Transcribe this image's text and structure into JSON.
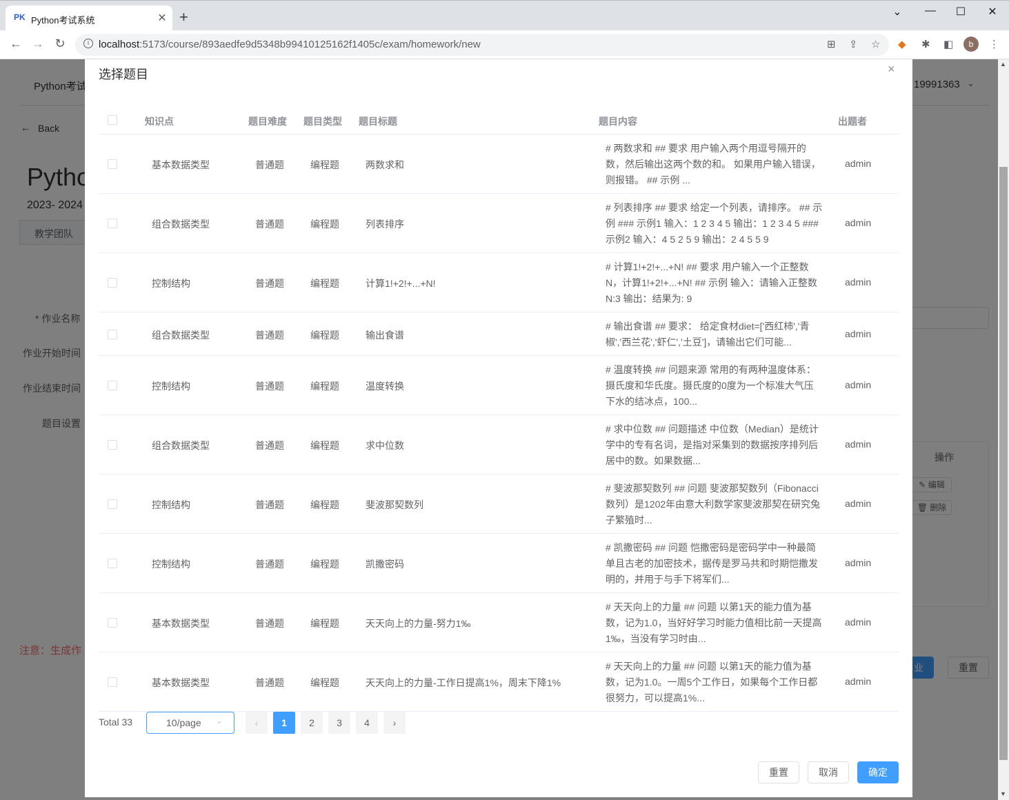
{
  "browser": {
    "tab_favicon": "PK",
    "tab_title": "Python考试系统",
    "tab_close": "✕",
    "new_tab": "+",
    "url_host": "localhost",
    "url_rest": ":5173/course/893aedfe9d5348b99410125162f1405c/exam/homework/new",
    "avatar": "b",
    "window_controls": [
      "⌄",
      "—",
      "☐",
      "✕"
    ]
  },
  "background": {
    "header_title": "Python考试",
    "user_id": "19991363",
    "back_label": "Back",
    "course_title": "Pytho",
    "term": "2023- 2024",
    "team_tab": "教学团队",
    "field_name_label": "* 作业名称",
    "field_start_label": "作业开始时间",
    "field_end_label": "作业结束时间",
    "field_questions_label": "题目设置",
    "ops_header": "操作",
    "edit_label": "编辑",
    "delete_label": "删除",
    "notice": "注意：生成作",
    "submit_partial": "业",
    "reset_label": "重置"
  },
  "dialog": {
    "title": "选择题目",
    "close": "×",
    "columns": [
      "知识点",
      "题目难度",
      "题目类型",
      "题目标题",
      "题目内容",
      "出题者"
    ],
    "rows": [
      {
        "topic": "基本数据类型",
        "difficulty": "普通题",
        "type": "编程题",
        "title": "两数求和",
        "content": "# 两数求和 ## 要求 用户输入两个用逗号隔开的数，然后输出这两个数的和。 如果用户输入错误，则报错。 ## 示例 ...",
        "author": "admin"
      },
      {
        "topic": "组合数据类型",
        "difficulty": "普通题",
        "type": "编程题",
        "title": "列表排序",
        "content": "# 列表排序 ## 要求 给定一个列表，请排序。 ## 示例 ### 示例1 输入：1 2 3 4 5 输出：1 2 3 4 5 ### 示例2 输入：4 5 2 5 9 输出：2 4 5 5 9",
        "author": "admin"
      },
      {
        "topic": "控制结构",
        "difficulty": "普通题",
        "type": "编程题",
        "title": "计算1!+2!+...+N!",
        "content": "# 计算1!+2!+...+N! ## 要求 用户输入一个正整数N，计算1!+2!+...+N! ## 示例 输入：请输入正整数N:3 输出：结果为: 9",
        "author": "admin"
      },
      {
        "topic": "组合数据类型",
        "difficulty": "普通题",
        "type": "编程题",
        "title": "输出食谱",
        "content": "# 输出食谱 ## 要求： 给定食材diet=['西红柿','青椒','西兰花','虾仁','土豆']，请输出它们可能...",
        "author": "admin"
      },
      {
        "topic": "控制结构",
        "difficulty": "普通题",
        "type": "编程题",
        "title": "温度转换",
        "content": "# 温度转换 ## 问题来源 常用的有两种温度体系：摄氏度和华氏度。摄氏度的0度为一个标准大气压下水的结冰点，100...",
        "author": "admin"
      },
      {
        "topic": "组合数据类型",
        "difficulty": "普通题",
        "type": "编程题",
        "title": "求中位数",
        "content": "# 求中位数 ## 问题描述 中位数（Median）是统计学中的专有名词，是指对采集到的数据按序排列后居中的数。如果数据...",
        "author": "admin"
      },
      {
        "topic": "控制结构",
        "difficulty": "普通题",
        "type": "编程题",
        "title": "斐波那契数列",
        "content": "# 斐波那契数列 ## 问题 斐波那契数列（Fibonacci数列）是1202年由意大利数学家斐波那契在研究兔子繁殖时...",
        "author": "admin"
      },
      {
        "topic": "控制结构",
        "difficulty": "普通题",
        "type": "编程题",
        "title": "凯撒密码",
        "content": "# 凯撒密码 ## 问题 恺撒密码是密码学中一种最简单且古老的加密技术，据传是罗马共和时期恺撒发明的，并用于与手下将军们...",
        "author": "admin"
      },
      {
        "topic": "基本数据类型",
        "difficulty": "普通题",
        "type": "编程题",
        "title": "天天向上的力量-努力1‰",
        "content": "# 天天向上的力量 ## 问题 以第1天的能力值为基数，记为1.0，当好好学习时能力值相比前一天提高1‰，当没有学习时由...",
        "author": "admin"
      },
      {
        "topic": "基本数据类型",
        "difficulty": "普通题",
        "type": "编程题",
        "title": "天天向上的力量-工作日提高1%，周末下降1%",
        "content": "# 天天向上的力量 ## 问题 以第1天的能力值为基数，记为1.0。一周5个工作日，如果每个工作日都很努力，可以提高1%...",
        "author": "admin"
      }
    ],
    "pagination": {
      "total": "Total 33",
      "page_size": "10/page",
      "prev": "‹",
      "next": "›",
      "pages": [
        "1",
        "2",
        "3",
        "4"
      ],
      "current": 1
    },
    "buttons": {
      "reset": "重置",
      "cancel": "取消",
      "confirm": "确定"
    }
  }
}
